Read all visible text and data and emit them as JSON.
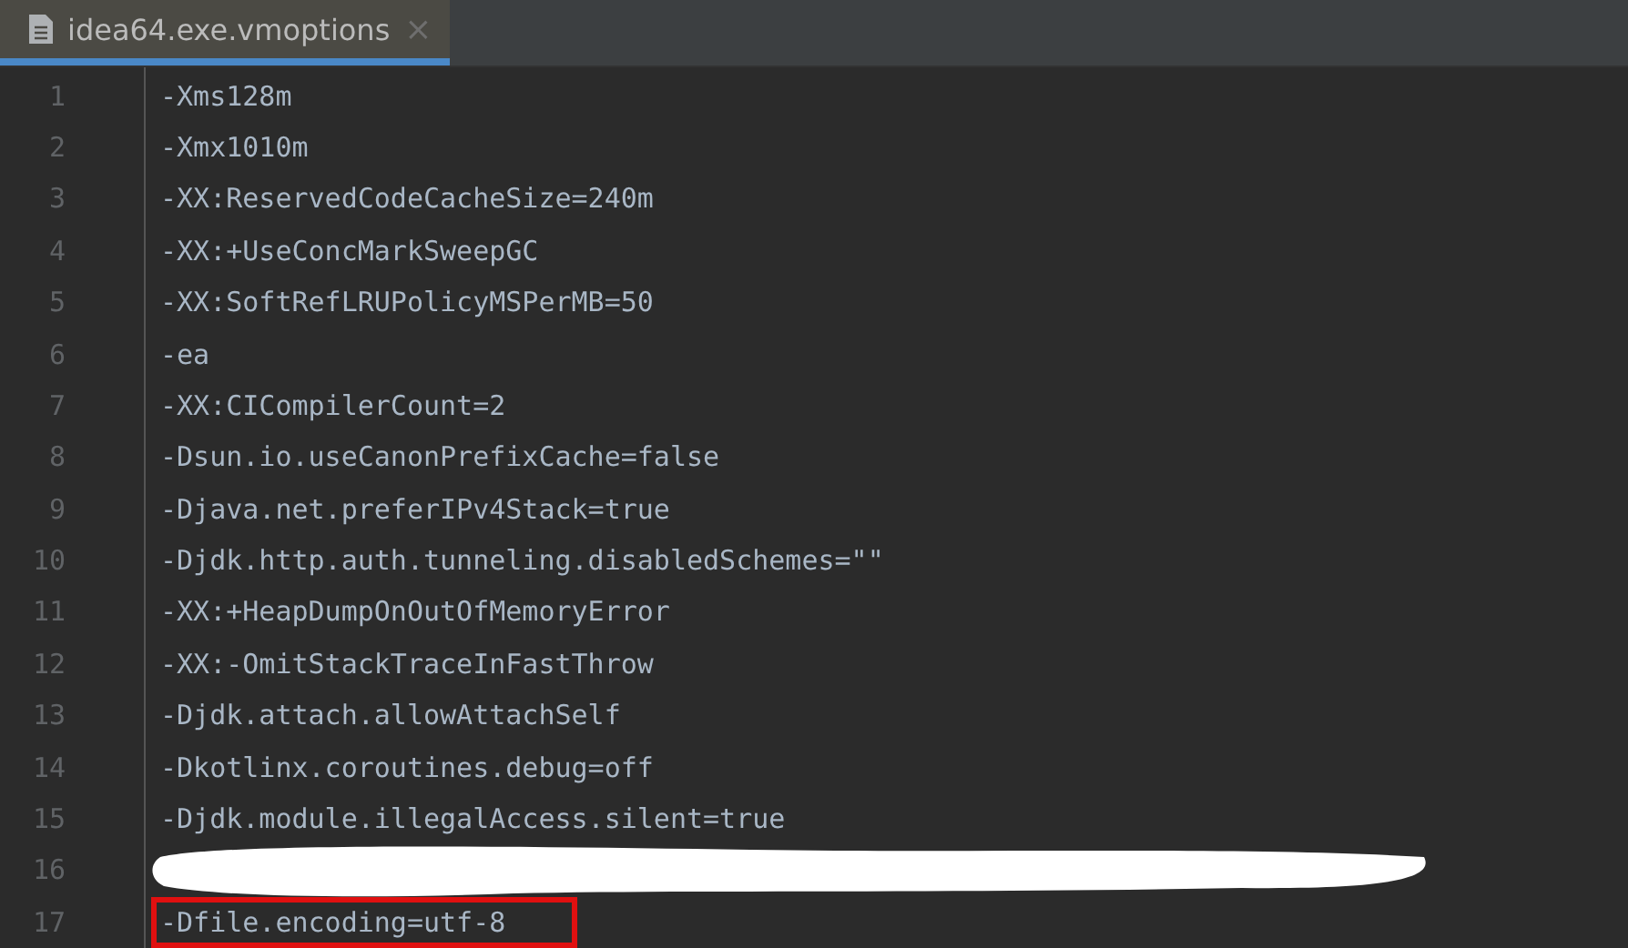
{
  "tabs": [
    {
      "label": "idea64.exe.vmoptions",
      "close": "×",
      "selected": true
    }
  ],
  "lines": [
    {
      "number": "1",
      "text": "-Xms128m",
      "redacted": false,
      "highlighted": false
    },
    {
      "number": "2",
      "text": "-Xmx1010m",
      "redacted": false,
      "highlighted": false
    },
    {
      "number": "3",
      "text": "-XX:ReservedCodeCacheSize=240m",
      "redacted": false,
      "highlighted": false
    },
    {
      "number": "4",
      "text": "-XX:+UseConcMarkSweepGC",
      "redacted": false,
      "highlighted": false
    },
    {
      "number": "5",
      "text": "-XX:SoftRefLRUPolicyMSPerMB=50",
      "redacted": false,
      "highlighted": false
    },
    {
      "number": "6",
      "text": "-ea",
      "redacted": false,
      "highlighted": false
    },
    {
      "number": "7",
      "text": "-XX:CICompilerCount=2",
      "redacted": false,
      "highlighted": false
    },
    {
      "number": "8",
      "text": "-Dsun.io.useCanonPrefixCache=false",
      "redacted": false,
      "highlighted": false
    },
    {
      "number": "9",
      "text": "-Djava.net.preferIPv4Stack=true",
      "redacted": false,
      "highlighted": false
    },
    {
      "number": "10",
      "text": "-Djdk.http.auth.tunneling.disabledSchemes=\"\"",
      "redacted": false,
      "highlighted": false
    },
    {
      "number": "11",
      "text": "-XX:+HeapDumpOnOutOfMemoryError",
      "redacted": false,
      "highlighted": false
    },
    {
      "number": "12",
      "text": "-XX:-OmitStackTraceInFastThrow",
      "redacted": false,
      "highlighted": false
    },
    {
      "number": "13",
      "text": "-Djdk.attach.allowAttachSelf",
      "redacted": false,
      "highlighted": false
    },
    {
      "number": "14",
      "text": "-Dkotlinx.coroutines.debug=off",
      "redacted": false,
      "highlighted": false
    },
    {
      "number": "15",
      "text": "-Djdk.module.illegalAccess.silent=true",
      "redacted": false,
      "highlighted": false
    },
    {
      "number": "16",
      "redacted": true,
      "highlighted": false
    },
    {
      "number": "17",
      "text": "-Dfile.encoding=utf-8",
      "redacted": false,
      "highlighted": true
    }
  ]
}
